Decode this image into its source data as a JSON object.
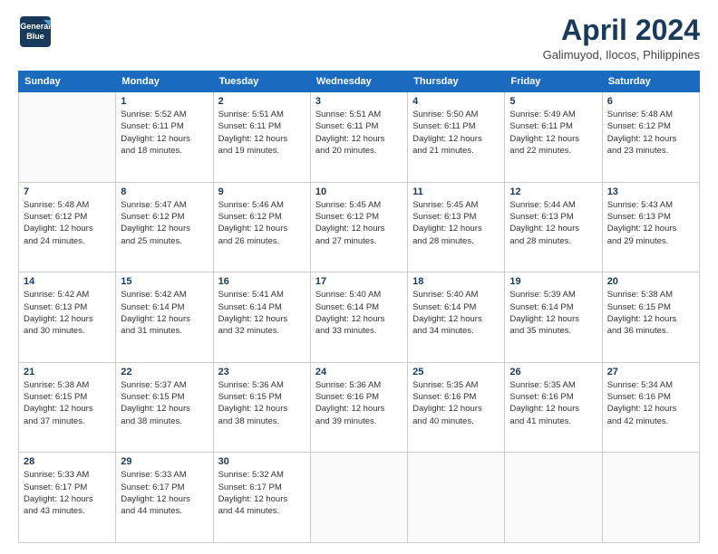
{
  "logo": {
    "line1": "General",
    "line2": "Blue"
  },
  "title": "April 2024",
  "subtitle": "Galimuyod, Ilocos, Philippines",
  "weekdays": [
    "Sunday",
    "Monday",
    "Tuesday",
    "Wednesday",
    "Thursday",
    "Friday",
    "Saturday"
  ],
  "weeks": [
    [
      {
        "day": "",
        "info": ""
      },
      {
        "day": "1",
        "info": "Sunrise: 5:52 AM\nSunset: 6:11 PM\nDaylight: 12 hours\nand 18 minutes."
      },
      {
        "day": "2",
        "info": "Sunrise: 5:51 AM\nSunset: 6:11 PM\nDaylight: 12 hours\nand 19 minutes."
      },
      {
        "day": "3",
        "info": "Sunrise: 5:51 AM\nSunset: 6:11 PM\nDaylight: 12 hours\nand 20 minutes."
      },
      {
        "day": "4",
        "info": "Sunrise: 5:50 AM\nSunset: 6:11 PM\nDaylight: 12 hours\nand 21 minutes."
      },
      {
        "day": "5",
        "info": "Sunrise: 5:49 AM\nSunset: 6:11 PM\nDaylight: 12 hours\nand 22 minutes."
      },
      {
        "day": "6",
        "info": "Sunrise: 5:48 AM\nSunset: 6:12 PM\nDaylight: 12 hours\nand 23 minutes."
      }
    ],
    [
      {
        "day": "7",
        "info": "Sunrise: 5:48 AM\nSunset: 6:12 PM\nDaylight: 12 hours\nand 24 minutes."
      },
      {
        "day": "8",
        "info": "Sunrise: 5:47 AM\nSunset: 6:12 PM\nDaylight: 12 hours\nand 25 minutes."
      },
      {
        "day": "9",
        "info": "Sunrise: 5:46 AM\nSunset: 6:12 PM\nDaylight: 12 hours\nand 26 minutes."
      },
      {
        "day": "10",
        "info": "Sunrise: 5:45 AM\nSunset: 6:12 PM\nDaylight: 12 hours\nand 27 minutes."
      },
      {
        "day": "11",
        "info": "Sunrise: 5:45 AM\nSunset: 6:13 PM\nDaylight: 12 hours\nand 28 minutes."
      },
      {
        "day": "12",
        "info": "Sunrise: 5:44 AM\nSunset: 6:13 PM\nDaylight: 12 hours\nand 28 minutes."
      },
      {
        "day": "13",
        "info": "Sunrise: 5:43 AM\nSunset: 6:13 PM\nDaylight: 12 hours\nand 29 minutes."
      }
    ],
    [
      {
        "day": "14",
        "info": "Sunrise: 5:42 AM\nSunset: 6:13 PM\nDaylight: 12 hours\nand 30 minutes."
      },
      {
        "day": "15",
        "info": "Sunrise: 5:42 AM\nSunset: 6:14 PM\nDaylight: 12 hours\nand 31 minutes."
      },
      {
        "day": "16",
        "info": "Sunrise: 5:41 AM\nSunset: 6:14 PM\nDaylight: 12 hours\nand 32 minutes."
      },
      {
        "day": "17",
        "info": "Sunrise: 5:40 AM\nSunset: 6:14 PM\nDaylight: 12 hours\nand 33 minutes."
      },
      {
        "day": "18",
        "info": "Sunrise: 5:40 AM\nSunset: 6:14 PM\nDaylight: 12 hours\nand 34 minutes."
      },
      {
        "day": "19",
        "info": "Sunrise: 5:39 AM\nSunset: 6:14 PM\nDaylight: 12 hours\nand 35 minutes."
      },
      {
        "day": "20",
        "info": "Sunrise: 5:38 AM\nSunset: 6:15 PM\nDaylight: 12 hours\nand 36 minutes."
      }
    ],
    [
      {
        "day": "21",
        "info": "Sunrise: 5:38 AM\nSunset: 6:15 PM\nDaylight: 12 hours\nand 37 minutes."
      },
      {
        "day": "22",
        "info": "Sunrise: 5:37 AM\nSunset: 6:15 PM\nDaylight: 12 hours\nand 38 minutes."
      },
      {
        "day": "23",
        "info": "Sunrise: 5:36 AM\nSunset: 6:15 PM\nDaylight: 12 hours\nand 38 minutes."
      },
      {
        "day": "24",
        "info": "Sunrise: 5:36 AM\nSunset: 6:16 PM\nDaylight: 12 hours\nand 39 minutes."
      },
      {
        "day": "25",
        "info": "Sunrise: 5:35 AM\nSunset: 6:16 PM\nDaylight: 12 hours\nand 40 minutes."
      },
      {
        "day": "26",
        "info": "Sunrise: 5:35 AM\nSunset: 6:16 PM\nDaylight: 12 hours\nand 41 minutes."
      },
      {
        "day": "27",
        "info": "Sunrise: 5:34 AM\nSunset: 6:16 PM\nDaylight: 12 hours\nand 42 minutes."
      }
    ],
    [
      {
        "day": "28",
        "info": "Sunrise: 5:33 AM\nSunset: 6:17 PM\nDaylight: 12 hours\nand 43 minutes."
      },
      {
        "day": "29",
        "info": "Sunrise: 5:33 AM\nSunset: 6:17 PM\nDaylight: 12 hours\nand 44 minutes."
      },
      {
        "day": "30",
        "info": "Sunrise: 5:32 AM\nSunset: 6:17 PM\nDaylight: 12 hours\nand 44 minutes."
      },
      {
        "day": "",
        "info": ""
      },
      {
        "day": "",
        "info": ""
      },
      {
        "day": "",
        "info": ""
      },
      {
        "day": "",
        "info": ""
      }
    ]
  ]
}
